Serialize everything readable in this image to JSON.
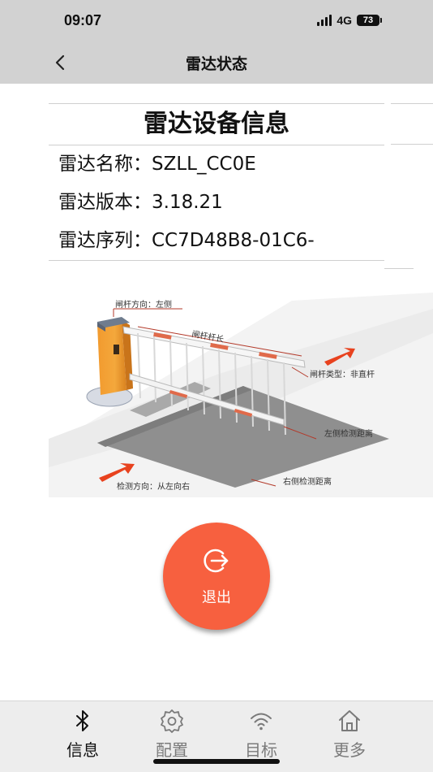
{
  "status_bar": {
    "time": "09:07",
    "network": "4G",
    "battery": "73"
  },
  "nav": {
    "title": "雷达状态",
    "back_icon": "chevron-left-icon"
  },
  "device_card": {
    "heading": "雷达设备信息",
    "rows": [
      {
        "label": "雷达名称：",
        "value": "SZLL_CC0E"
      },
      {
        "label": "雷达版本：",
        "value": "3.18.21"
      },
      {
        "label": "雷达序列：",
        "value": "CC7D48B8-01C6-"
      }
    ]
  },
  "diagram": {
    "gate_direction": "闸杆方向：左侧",
    "bar_length": "闸杆杆长",
    "bar_type": "闸杆类型：非直杆",
    "left_distance": "左侧检测距离",
    "right_distance": "右侧检测距离",
    "detect_direction": "检测方向：从左向右"
  },
  "exit_button": {
    "label": "退出",
    "icon": "exit-icon",
    "color": "#f7603f"
  },
  "tab_bar": {
    "items": [
      {
        "label": "信息",
        "icon": "bluetooth-icon",
        "active": true
      },
      {
        "label": "配置",
        "icon": "gear-icon",
        "active": false
      },
      {
        "label": "目标",
        "icon": "wifi-icon",
        "active": false
      },
      {
        "label": "更多",
        "icon": "home-icon",
        "active": false
      }
    ],
    "active_color": "#111111",
    "inactive_color": "#7a7a7a"
  }
}
